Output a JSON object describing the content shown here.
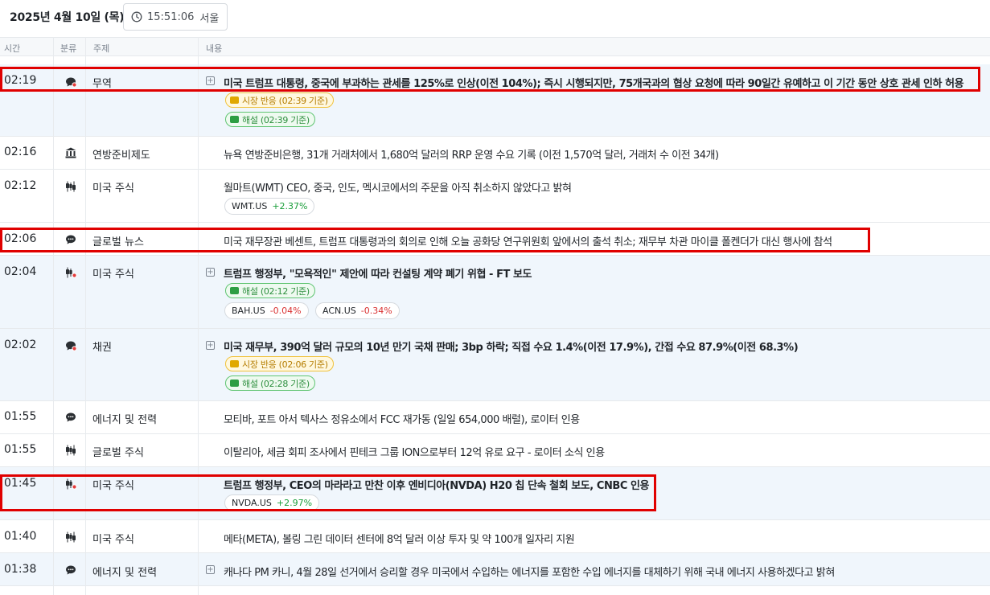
{
  "header": {
    "date": "2025년 4월 10일 (목)",
    "time": "15:51:06",
    "city": "서울"
  },
  "columns": {
    "time": "시간",
    "category": "분류",
    "topic": "주제",
    "content": "내용"
  },
  "colors": {
    "highlight_row": "#f0f6fc",
    "red_box": "#e00000",
    "positive": "#1a9e3a",
    "negative": "#d93030"
  },
  "rows": [
    {
      "time": "02:19",
      "icon": "chat-alert-icon",
      "topic": "무역",
      "headline": "미국 트럼프 대통령, 중국에 부과하는 관세를 125%로 인상(이전 104%); 즉시 시행되지만, 75개국과의 협상 요청에 따라 90일간 유예하고 이 기간 동안 상호 관세 인하 허용",
      "market_reaction": "시장 반응 (02:39 기준)",
      "analysis": "해설 (02:39 기준)"
    },
    {
      "time": "02:16",
      "icon": "bank-icon",
      "topic": "연방준비제도",
      "headline": "뉴욕 연방준비은행, 31개 거래처에서 1,680억 달러의 RRP 운영 수요 기록 (이전 1,570억 달러, 거래처 수 이전 34개)"
    },
    {
      "time": "02:12",
      "icon": "candlestick-icon",
      "topic": "미국 주식",
      "headline": "월마트(WMT) CEO, 중국, 인도, 멕시코에서의 주문을 아직 취소하지 않았다고 밝혀",
      "tickers": [
        {
          "symbol": "WMT.US",
          "change": "+2.37%"
        }
      ]
    },
    {
      "time": "02:06",
      "icon": "chat-icon",
      "topic": "글로벌 뉴스",
      "headline": "미국 재무장관 베센트, 트럼프 대통령과의 회의로 인해 오늘 공화당 연구위원회 앞에서의 출석 취소; 재무부 차관 마이클 폴켄더가 대신 행사에 참석"
    },
    {
      "time": "02:04",
      "icon": "candlestick-alert-icon",
      "topic": "미국 주식",
      "headline": "트럼프 행정부, \"모욕적인\" 제안에 따라 컨설팅 계약 폐기 위협 - FT 보도",
      "analysis": "해설 (02:12 기준)",
      "tickers": [
        {
          "symbol": "BAH.US",
          "change": "-0.04%"
        },
        {
          "symbol": "ACN.US",
          "change": "-0.34%"
        }
      ]
    },
    {
      "time": "02:02",
      "icon": "chat-alert-icon",
      "topic": "채권",
      "headline": "미국 재무부, 390억 달러 규모의 10년 만기 국채 판매; 3bp 하락; 직접 수요 1.4%(이전 17.9%), 간접 수요 87.9%(이전 68.3%)",
      "market_reaction": "시장 반응 (02:06 기준)",
      "analysis": "해설 (02:28 기준)"
    },
    {
      "time": "01:55",
      "icon": "chat-icon",
      "topic": "에너지 및 전력",
      "headline": "모티바, 포트 아서 텍사스 정유소에서 FCC 재가동 (일일 654,000 배럴), 로이터 인용"
    },
    {
      "time": "01:55",
      "icon": "candlestick-icon",
      "topic": "글로벌 주식",
      "headline": "이탈리아, 세금 회피 조사에서 핀테크 그룹 ION으로부터 12억 유로 요구 - 로이터 소식 인용"
    },
    {
      "time": "01:45",
      "icon": "candlestick-alert-icon",
      "topic": "미국 주식",
      "headline": "트럼프 행정부, CEO의 마라라고 만찬 이후 엔비디아(NVDA) H20 칩 단속 철회 보도, CNBC 인용",
      "tickers": [
        {
          "symbol": "NVDA.US",
          "change": "+2.97%"
        }
      ]
    },
    {
      "time": "01:40",
      "icon": "candlestick-icon",
      "topic": "미국 주식",
      "headline": "메타(META), 볼링 그린 데이터 센터에 8억 달러 이상 투자 및 약 100개 일자리 지원"
    },
    {
      "time": "01:38",
      "icon": "chat-icon",
      "topic": "에너지 및 전력",
      "headline": "캐나다 PM 카니, 4월 28일 선거에서 승리할 경우 미국에서 수입하는 에너지를 포함한 수입 에너지를 대체하기 위해 국내 에너지 사용하겠다고 밝혀"
    }
  ]
}
